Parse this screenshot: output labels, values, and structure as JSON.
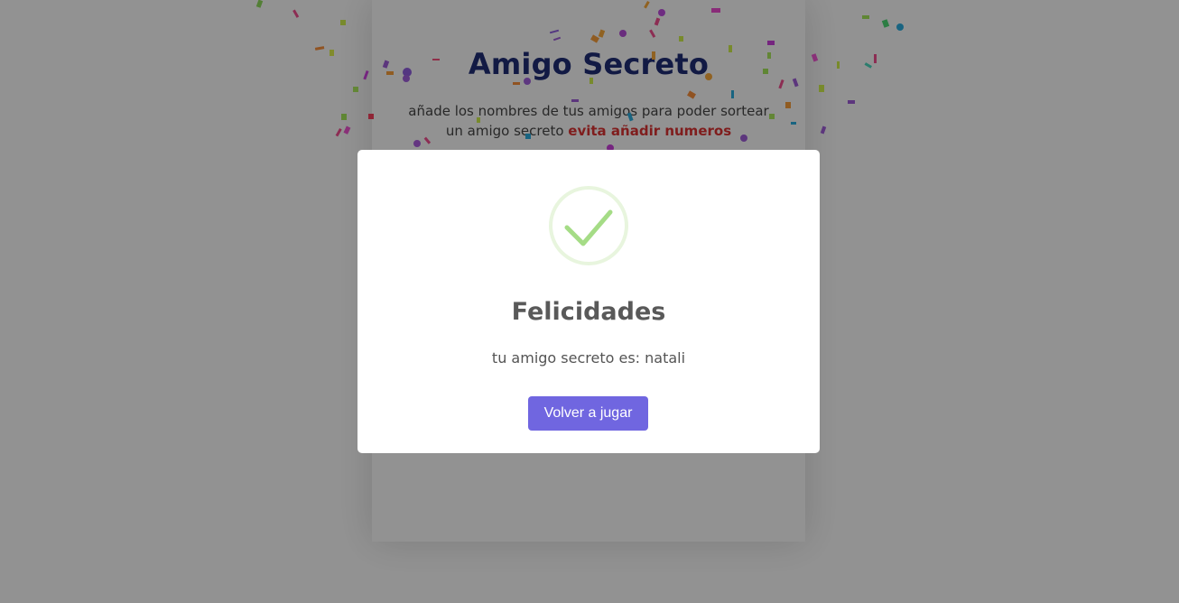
{
  "app": {
    "title": "Amigo Secreto",
    "description": "añade los nombres de tus amigos para poder sortear un amigo secreto",
    "warning": "evita añadir numeros"
  },
  "modal": {
    "icon": "success-check-icon",
    "title": "Felicidades",
    "text": "tu amigo secreto es: natali",
    "confirm_label": "Volver a jugar"
  },
  "colors": {
    "title": "#1f2c72",
    "warning": "#d43131",
    "button": "#7066e0",
    "success": "#a5dc86",
    "overlay": "rgba(0,0,0,0.40)"
  }
}
